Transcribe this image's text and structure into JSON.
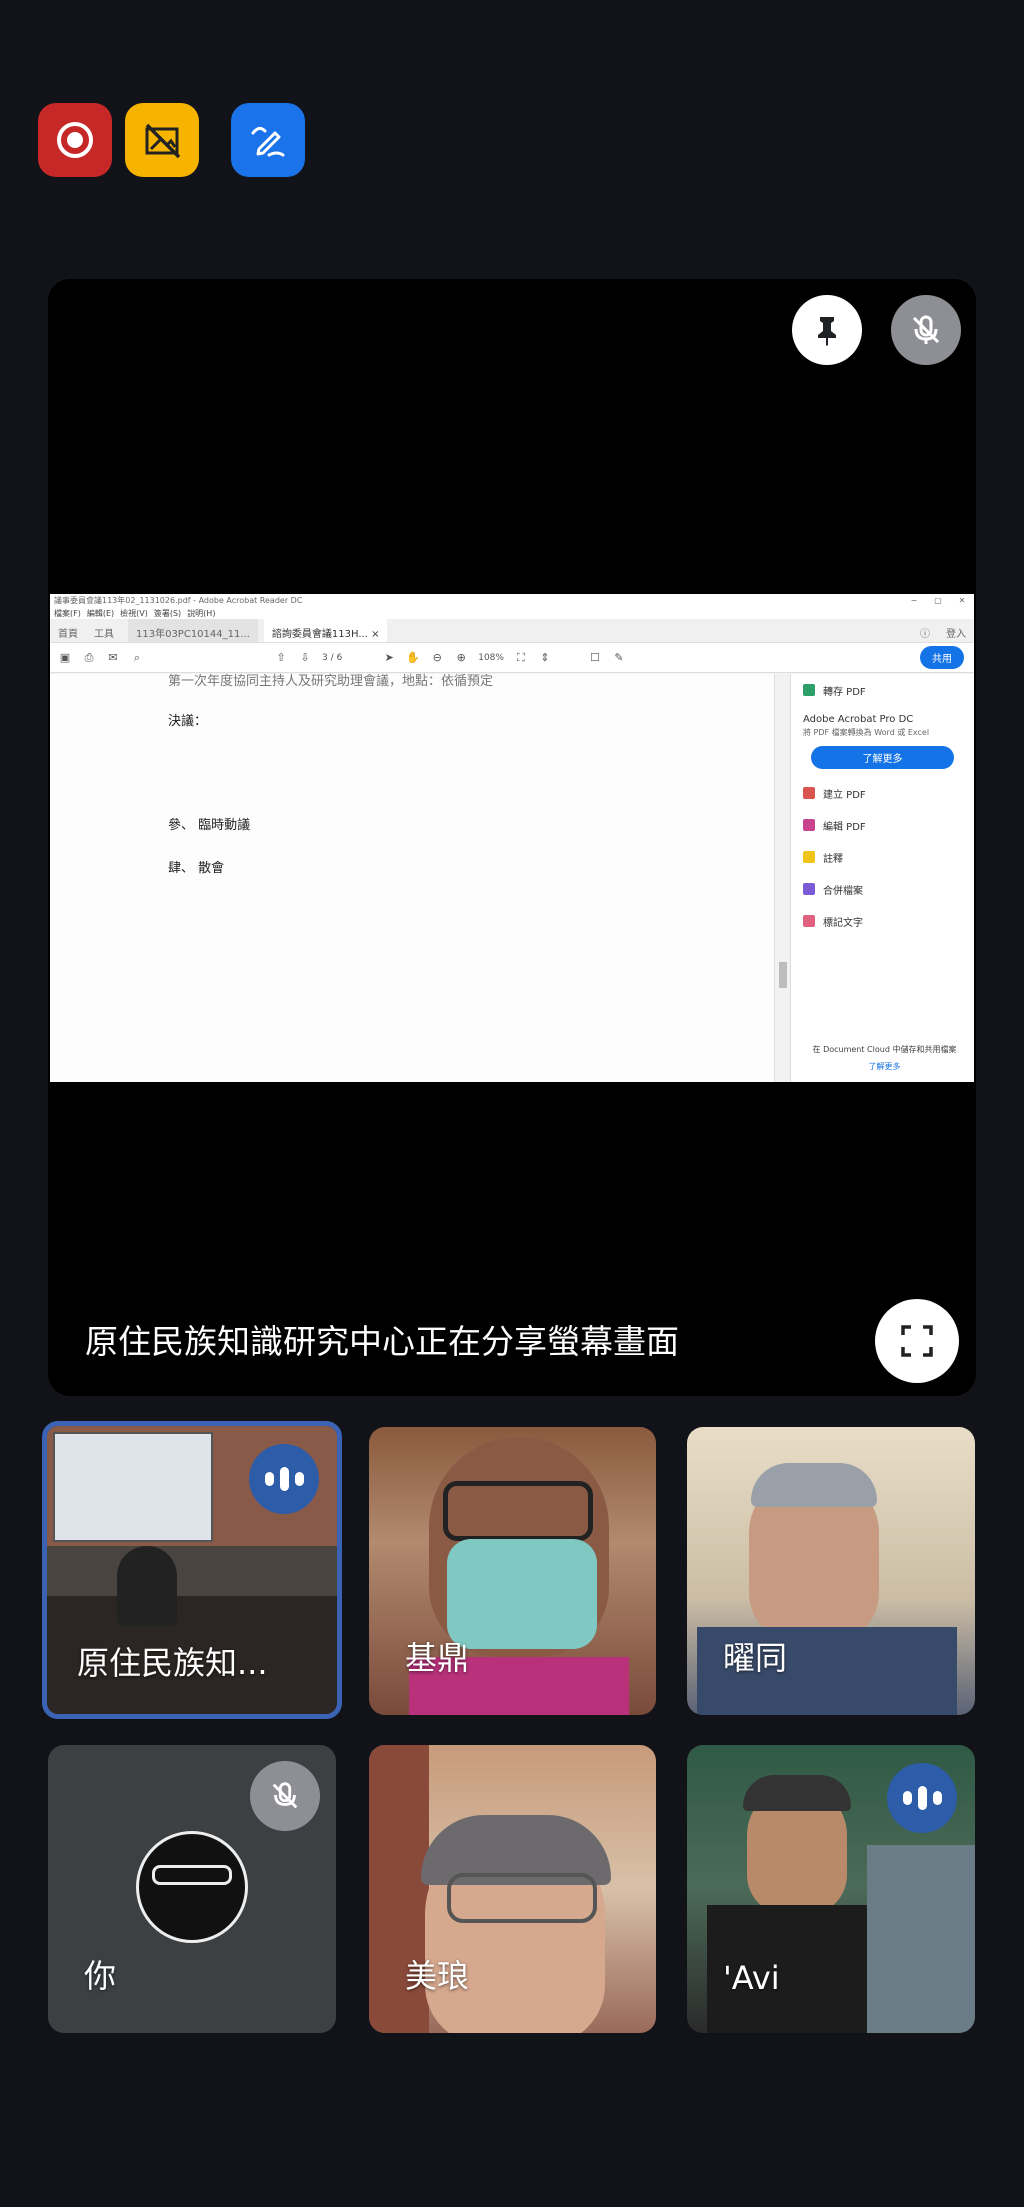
{
  "top_controls": {
    "record_icon": "record-icon",
    "camera_off_icon": "no-camera-icon",
    "annotate_icon": "annotate-pen-icon",
    "colors": {
      "record": "#c62828",
      "camera_off": "#f6b400",
      "annotate": "#1a73e8"
    }
  },
  "stage": {
    "share_text": "原住民族知識研究中心正在分享螢幕畫面",
    "pin_icon": "pin-icon",
    "muted_icon": "mic-off-icon",
    "fullscreen_icon": "fullscreen-icon"
  },
  "pdf": {
    "title_bar": "議事委員會議113年02_1131026.pdf - Adobe Acrobat Reader DC",
    "window_controls": [
      "−",
      "▢",
      "✕"
    ],
    "menu": [
      "檔案(F)",
      "編輯(E)",
      "檢視(V)",
      "簽署(S)",
      "說明(H)"
    ],
    "tabs": [
      "首頁",
      "工具",
      "113年03PC10144_11...",
      "諮詢委員會議113H..."
    ],
    "tab_close": "×",
    "signin": "登入",
    "page_indicator": "3 / 6",
    "zoom": "108%",
    "share_button": "共用",
    "doc_lines": {
      "top_partial": "第一次年度協同主持人及研究助理會議，地點：依循預定",
      "resolution": "決議：",
      "item3": "參、 臨時動議",
      "item4": "肆、 散會"
    },
    "side_panel": {
      "export_pdf": "轉存 PDF",
      "promo_title": "Adobe Acrobat Pro DC",
      "promo_desc": "將 PDF 檔案轉換為 Word 或 Excel",
      "learn_more": "了解更多",
      "tools": [
        "建立 PDF",
        "編輯 PDF",
        "註釋",
        "合併檔案",
        "標記文字"
      ],
      "footer": "在 Document Cloud 中儲存和共用檔案",
      "footer_link": "了解更多"
    }
  },
  "participants": [
    {
      "name": "原住民族知...",
      "status": "speaking"
    },
    {
      "name": "基鼎",
      "status": "none"
    },
    {
      "name": "曜同",
      "status": "none"
    },
    {
      "name": "你",
      "status": "muted"
    },
    {
      "name": "美琅",
      "status": "none"
    },
    {
      "name": "'Avi",
      "status": "speaking"
    }
  ]
}
